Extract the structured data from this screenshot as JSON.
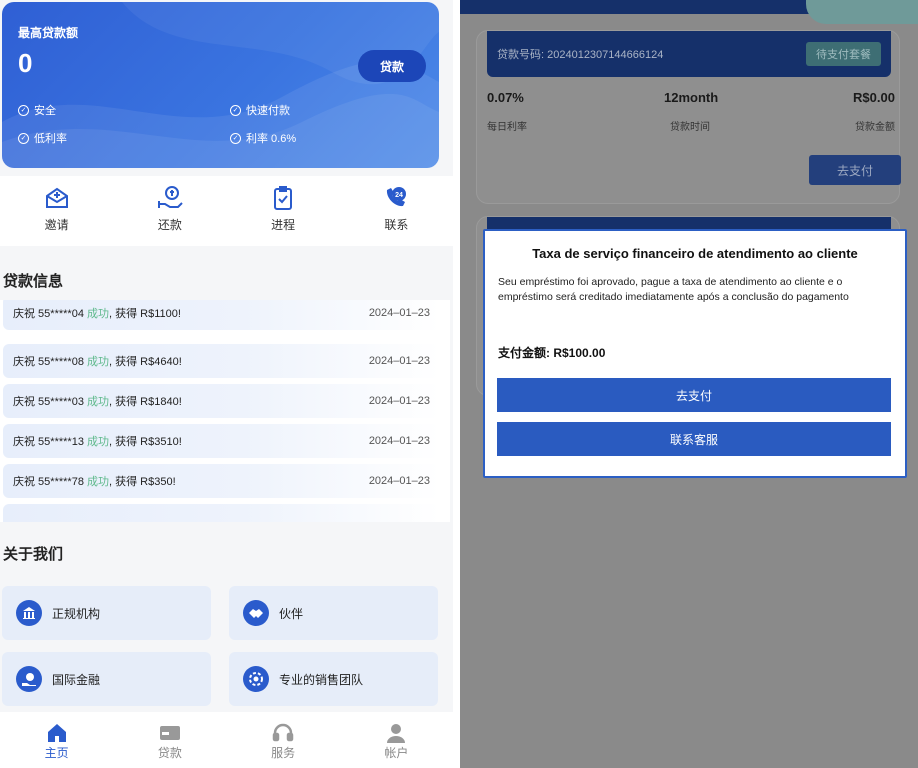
{
  "hero": {
    "title": "最高贷款额",
    "amount": "0",
    "loan_button": "贷款",
    "features": [
      "安全",
      "快速付款",
      "低利率",
      "利率 0.6%"
    ]
  },
  "quick": [
    {
      "label": "邀请",
      "icon": "invite-icon"
    },
    {
      "label": "还款",
      "icon": "repay-icon"
    },
    {
      "label": "进程",
      "icon": "progress-icon"
    },
    {
      "label": "联系",
      "icon": "contact-24-icon"
    }
  ],
  "loan_info": {
    "title": "贷款信息",
    "rows": [
      {
        "prefix": "庆祝 55*****04 ",
        "status": "成功",
        "suffix": ", 获得 R$1100!",
        "date": "2024–01–23"
      },
      {
        "prefix": "庆祝 55*****08 ",
        "status": "成功",
        "suffix": ", 获得 R$4640!",
        "date": "2024–01–23"
      },
      {
        "prefix": "庆祝 55*****03 ",
        "status": "成功",
        "suffix": ", 获得 R$1840!",
        "date": "2024–01–23"
      },
      {
        "prefix": "庆祝 55*****13 ",
        "status": "成功",
        "suffix": ", 获得 R$3510!",
        "date": "2024–01–23"
      },
      {
        "prefix": "庆祝 55*****78 ",
        "status": "成功",
        "suffix": ", 获得 R$350!",
        "date": "2024–01–23"
      }
    ]
  },
  "about": {
    "title": "关于我们",
    "cards": [
      "正规机构",
      "伙伴",
      "国际金融",
      "专业的销售团队"
    ]
  },
  "tabbar": [
    {
      "label": "主页",
      "icon": "home-icon",
      "active": true
    },
    {
      "label": "贷款",
      "icon": "card-icon",
      "active": false
    },
    {
      "label": "服务",
      "icon": "headset-icon",
      "active": false
    },
    {
      "label": "帐户",
      "icon": "user-icon",
      "active": false
    }
  ],
  "order": {
    "loan_no_label": "贷款号码: 2024012307144666124",
    "status_badge": "待支付套餐",
    "rate_value": "0.07%",
    "rate_label": "每日利率",
    "term_value": "12month",
    "term_label": "贷款时间",
    "amount_value": "R$0.00",
    "amount_label": "贷款金额",
    "pay_button": "去支付"
  },
  "modal": {
    "title": "Taxa de serviço financeiro de atendimento ao cliente",
    "message": "Seu empréstimo foi aprovado, pague a taxa de atendimento ao cliente e o empréstimo será creditado imediatamente após a conclusão do pagamento",
    "amount": "支付金额: R$100.00",
    "pay_button": "去支付",
    "contact_button": "联系客服"
  },
  "colors": {
    "primary": "#2a5bcc",
    "success": "#5fb98c",
    "header_dark": "#15306a"
  }
}
